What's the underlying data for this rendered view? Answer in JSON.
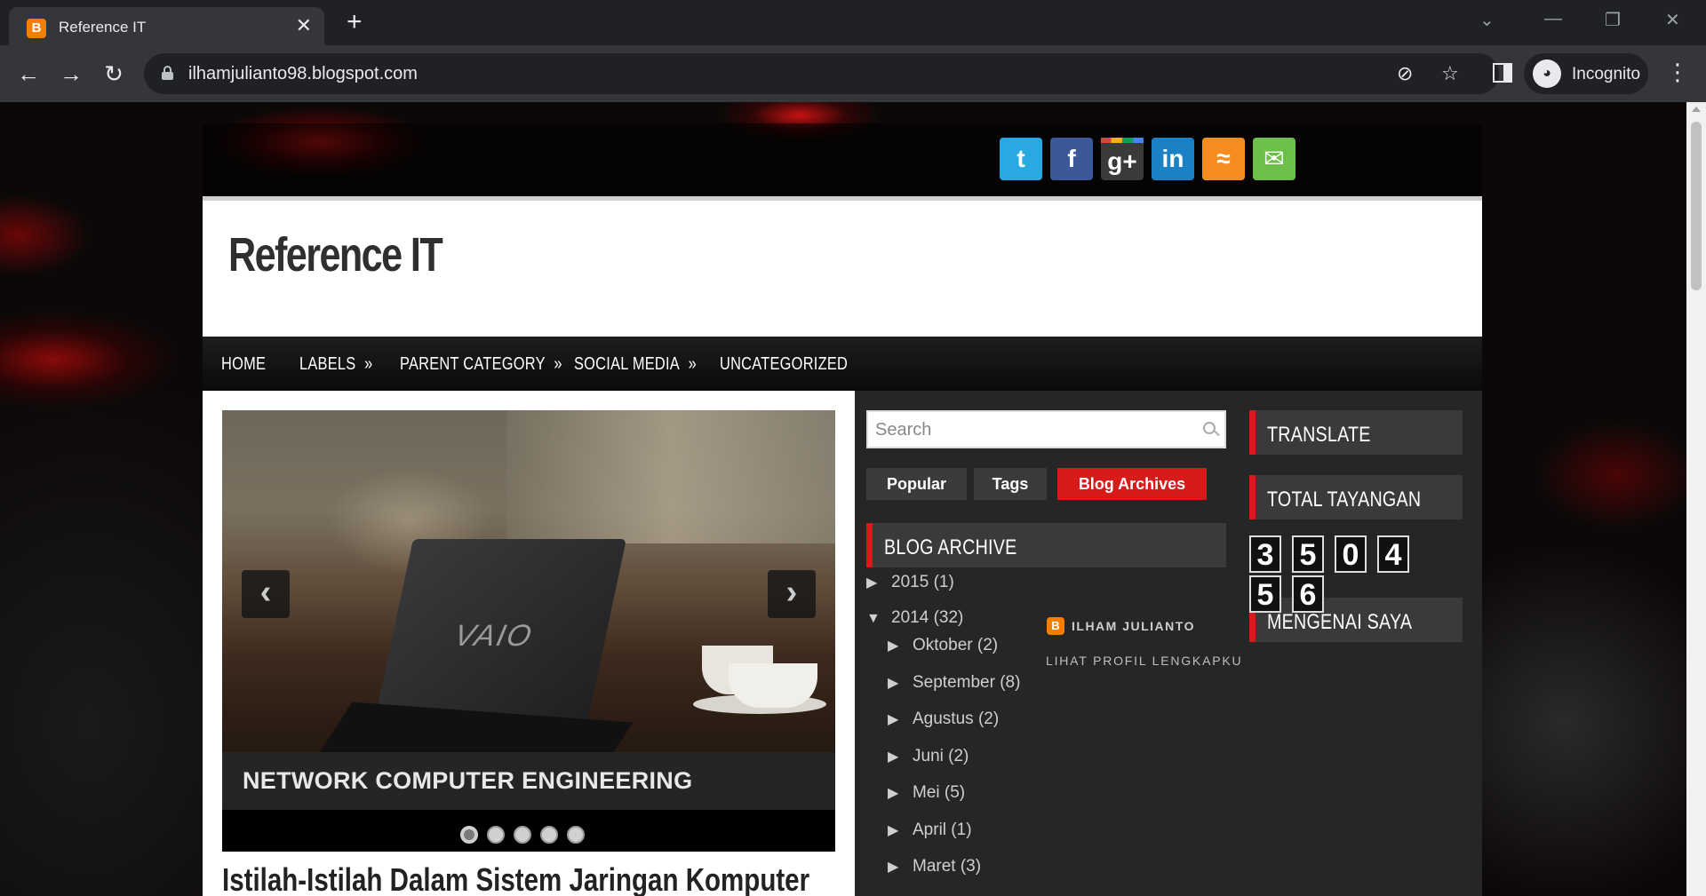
{
  "browser": {
    "tab_title": "Reference IT",
    "tab_favicon": "B",
    "url": "ilhamjulianto98.blogspot.com",
    "profile_label": "Incognito"
  },
  "site": {
    "title": "Reference IT",
    "social_icons": [
      "twitter-icon",
      "facebook-icon",
      "google-plus-icon",
      "linkedin-icon",
      "rss-icon",
      "email-icon"
    ],
    "social_glyphs": [
      "t",
      "f",
      "g+",
      "in",
      "≈",
      "✉"
    ],
    "social_colors": [
      "#29a9e1",
      "#3b5998",
      "#3a3a3a",
      "#1a82c4",
      "#f58d20",
      "#6cc04a"
    ],
    "nav": [
      {
        "label": "HOME",
        "arrow": ""
      },
      {
        "label": "LABELS",
        "arrow": "»"
      },
      {
        "label": "PARENT CATEGORY",
        "arrow": "»"
      },
      {
        "label": "SOCIAL MEDIA",
        "arrow": "»"
      },
      {
        "label": "UNCATEGORIZED",
        "arrow": ""
      }
    ],
    "slider": {
      "caption": "NETWORK COMPUTER ENGINEERING",
      "laptop_brand": "VAIO",
      "prev_glyph": "‹",
      "next_glyph": "›",
      "dot_count": 5,
      "active_dot": 1
    },
    "post_title": "Istilah-Istilah Dalam Sistem Jaringan Komputer",
    "search": {
      "placeholder": "Search"
    },
    "widget_tabs": [
      {
        "label": "Popular",
        "active": false
      },
      {
        "label": "Tags",
        "active": false
      },
      {
        "label": "Blog Archives",
        "active": true
      }
    ],
    "archive": {
      "heading": "BLOG ARCHIVE",
      "years": [
        {
          "label": "2015",
          "count": "(1)",
          "expanded": false
        },
        {
          "label": "2014",
          "count": "(32)",
          "expanded": true
        }
      ],
      "months": [
        {
          "label": "Oktober",
          "count": "(2)"
        },
        {
          "label": "September",
          "count": "(8)"
        },
        {
          "label": "Agustus",
          "count": "(2)"
        },
        {
          "label": "Juni",
          "count": "(2)"
        },
        {
          "label": "Mei",
          "count": "(5)"
        },
        {
          "label": "April",
          "count": "(1)"
        },
        {
          "label": "Maret",
          "count": "(3)"
        }
      ]
    },
    "sidebar": {
      "translate_heading": "TRANSLATE",
      "views_heading": "TOTAL TAYANGAN",
      "views_digits": [
        "3",
        "5",
        "0",
        "4",
        "5",
        "6"
      ],
      "about_heading": "MENGENAI SAYA",
      "profile_name": "ILHAM JULIANTO",
      "profile_link": "LIHAT PROFIL LENGKAPKU"
    }
  }
}
